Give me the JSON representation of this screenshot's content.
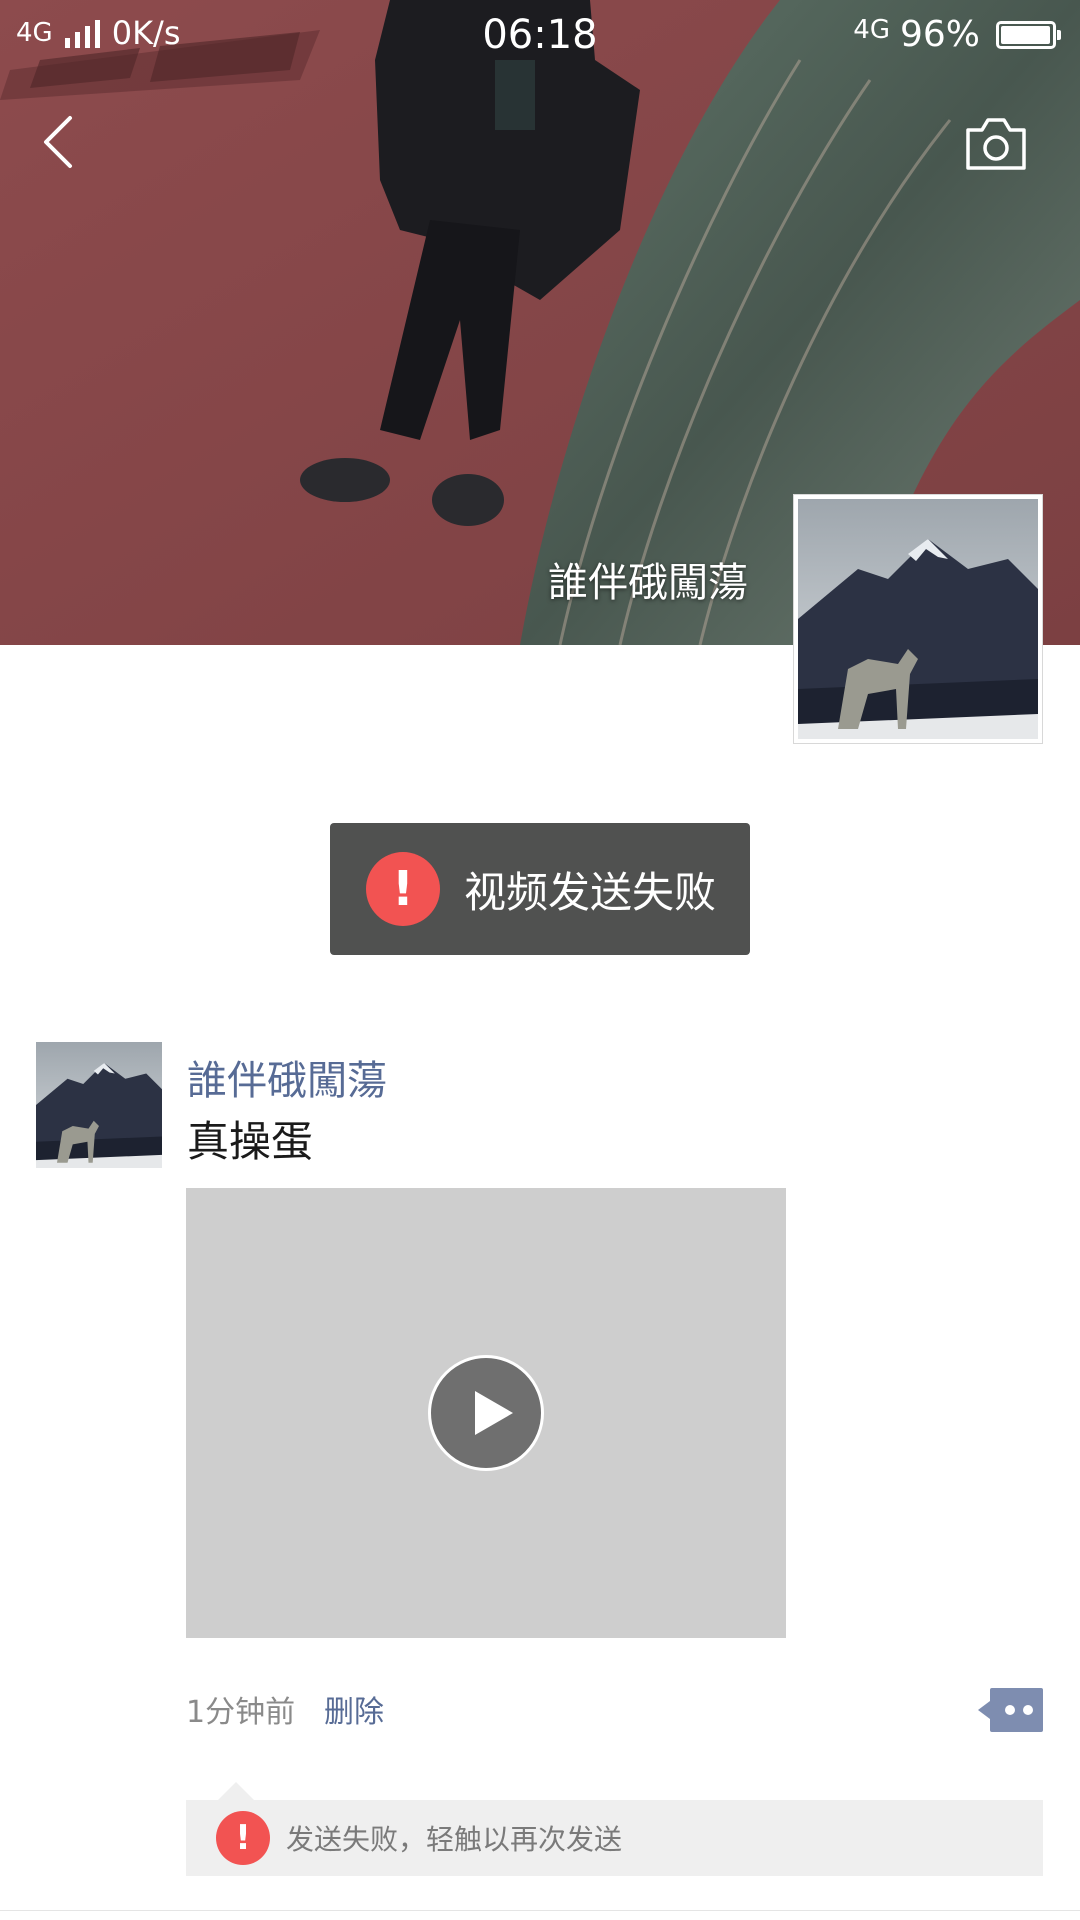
{
  "status_bar": {
    "network_left": "4G",
    "speed": "0K/s",
    "time": "06:18",
    "network_right": "4G",
    "battery": "96%",
    "battery_level": 0.96
  },
  "header": {
    "back_icon": "chevron-left-icon",
    "camera_icon": "camera-icon"
  },
  "profile": {
    "name": "誰伴硪闖蕩"
  },
  "toast": {
    "message": "视频发送失败",
    "icon": "!"
  },
  "post": {
    "author": "誰伴硪闖蕩",
    "text": "真操蛋",
    "time": "1分钟前",
    "delete_label": "删除",
    "fail_message": "发送失败，轻触以再次发送",
    "fail_icon": "!"
  },
  "colors": {
    "link": "#576b95",
    "error": "#f25352",
    "toast_bg": "#505150",
    "video_placeholder": "#cecece"
  }
}
